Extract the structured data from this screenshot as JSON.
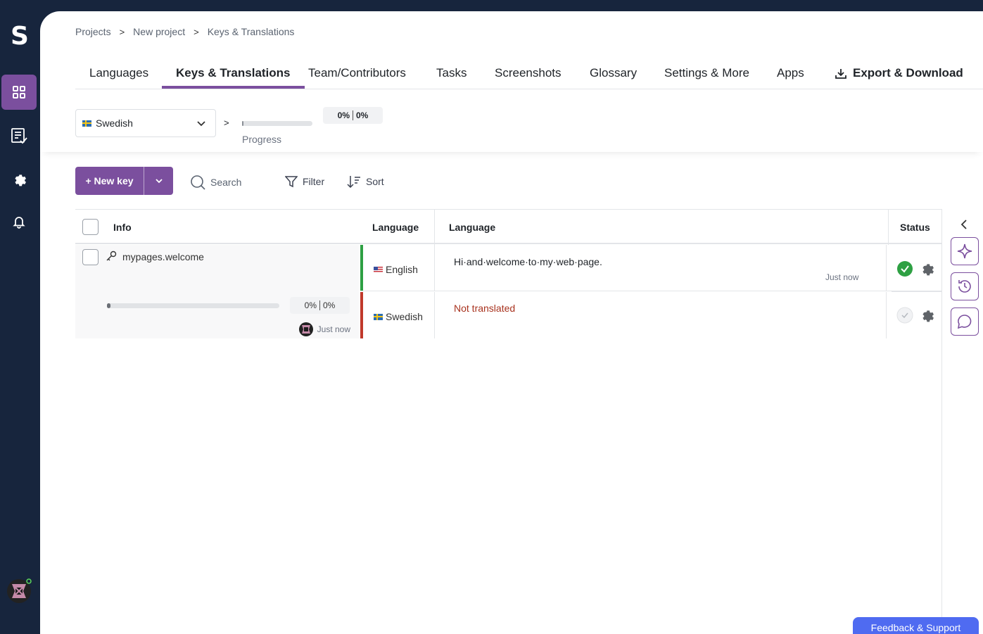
{
  "app": {
    "logo_letter": "S"
  },
  "breadcrumb": [
    "Projects",
    "New project",
    "Keys & Translations"
  ],
  "breadcrumb_sep": ">",
  "tabs": {
    "languages": "Languages",
    "keys": "Keys & Translations",
    "team": "Team/Contributors",
    "tasks": "Tasks",
    "screenshots": "Screenshots",
    "glossary": "Glossary",
    "settings": "Settings & More",
    "apps": "Apps",
    "export": "Export & Download"
  },
  "lang_select": {
    "value": "Swedish"
  },
  "lang_progress": {
    "separator": ">",
    "label": "Progress",
    "pct_a": "0%",
    "pct_b": "0%",
    "fill_fraction": 0.02
  },
  "toolbar": {
    "new_key": "+ New key",
    "search_placeholder": "Search",
    "filter": "Filter",
    "sort": "Sort"
  },
  "grid": {
    "headers": {
      "info": "Info",
      "language": "Language",
      "language2": "Language",
      "status": "Status"
    },
    "key": {
      "name": "mypages.welcome",
      "pct_a": "0%",
      "pct_b": "0%",
      "fill_fraction": 0.02,
      "time": "Just now"
    },
    "rows": [
      {
        "language": "English",
        "text": "Hi·and·welcome·to·my·web·page.",
        "time": "Just now",
        "stripe_color": "#2ea043",
        "text_color": "#1f2328"
      },
      {
        "language": "Swedish",
        "text": "Not translated",
        "time": "",
        "stripe_color": "#c0392b",
        "text_color": "#a8321e"
      }
    ]
  },
  "colors": {
    "accent": "#7b4f9e",
    "sidebar": "#17253d",
    "verified": "#2ea043",
    "feedback": "#4f6bf1"
  },
  "feedback": "Feedback & Support"
}
